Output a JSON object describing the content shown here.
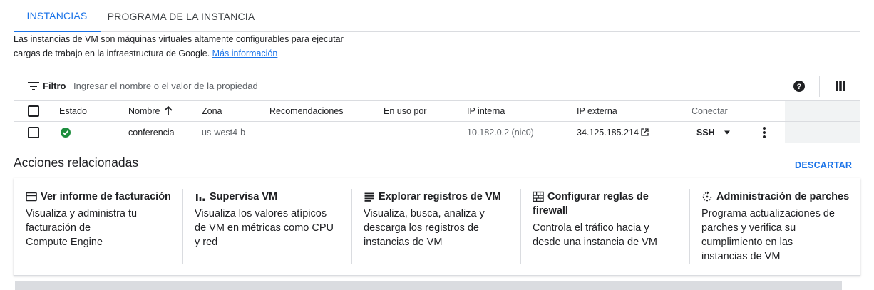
{
  "tabs": {
    "instances": "INSTANCIAS",
    "schedule": "PROGRAMA DE LA INSTANCIA"
  },
  "description": {
    "line1": "Las instancias de VM son máquinas virtuales altamente configurables para ejecutar",
    "line2": "cargas de trabajo en la infraestructura de Google.",
    "link": "Más información"
  },
  "filter": {
    "label": "Filtro",
    "placeholder": "Ingresar el nombre o el valor de la propiedad"
  },
  "table": {
    "columns": {
      "status": "Estado",
      "name": "Nombre",
      "zone": "Zona",
      "recommendations": "Recomendaciones",
      "in_use_by": "En uso por",
      "internal_ip": "IP interna",
      "external_ip": "IP externa",
      "connect": "Conectar"
    },
    "rows": [
      {
        "name": "conferencia",
        "zone": "us-west4-b",
        "internal_ip": "10.182.0.2 (nic0)",
        "external_ip": "34.125.185.214",
        "connect": "SSH"
      }
    ]
  },
  "related": {
    "title": "Acciones relacionadas",
    "dismiss": "DESCARTAR",
    "cards": [
      {
        "icon": "billing-icon",
        "title": "Ver informe de facturación",
        "body": [
          "Visualiza y administra tu",
          "facturación de",
          "Compute Engine"
        ]
      },
      {
        "icon": "monitoring-icon",
        "title": "Supervisa VM",
        "body": [
          "Visualiza los valores atípicos",
          "de VM en métricas como CPU",
          "y red"
        ]
      },
      {
        "icon": "logs-icon",
        "title": "Explorar registros de VM",
        "body": [
          "Visualiza, busca, analiza y",
          "descarga los registros de",
          "instancias de VM"
        ]
      },
      {
        "icon": "firewall-icon",
        "title_lines": [
          "Configurar reglas de",
          "firewall"
        ],
        "body": [
          "Controla el tráfico hacia y",
          "desde una instancia de VM"
        ]
      },
      {
        "icon": "patch-icon",
        "title": "Administración de parches",
        "body": [
          "Programa actualizaciones de",
          "parches y verifica su",
          "cumplimiento en las",
          "instancias de VM"
        ]
      }
    ]
  },
  "colors": {
    "accent": "#1a73e8",
    "status_ok": "#1e8e3e",
    "text": "#202124",
    "muted": "#5f6368",
    "divider": "#dadce0"
  }
}
